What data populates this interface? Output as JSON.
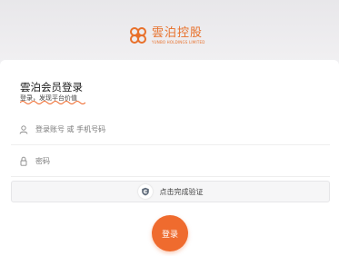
{
  "brand": {
    "name_cn": "雲泊控股",
    "name_en": "YUNBO HOLDINGS LIMITED",
    "accent_color": "#ef6b2e"
  },
  "form": {
    "title": "雲泊会员登录",
    "subtitle": "登录，发现平台价值",
    "account": {
      "value": "",
      "placeholder": "登录账号 或 手机号码",
      "icon": "user-icon"
    },
    "password": {
      "value": "",
      "placeholder": "密码",
      "icon": "lock-icon"
    },
    "verify": {
      "label": "点击完成验证",
      "icon": "captcha-shield-icon"
    },
    "submit_label": "登录"
  }
}
